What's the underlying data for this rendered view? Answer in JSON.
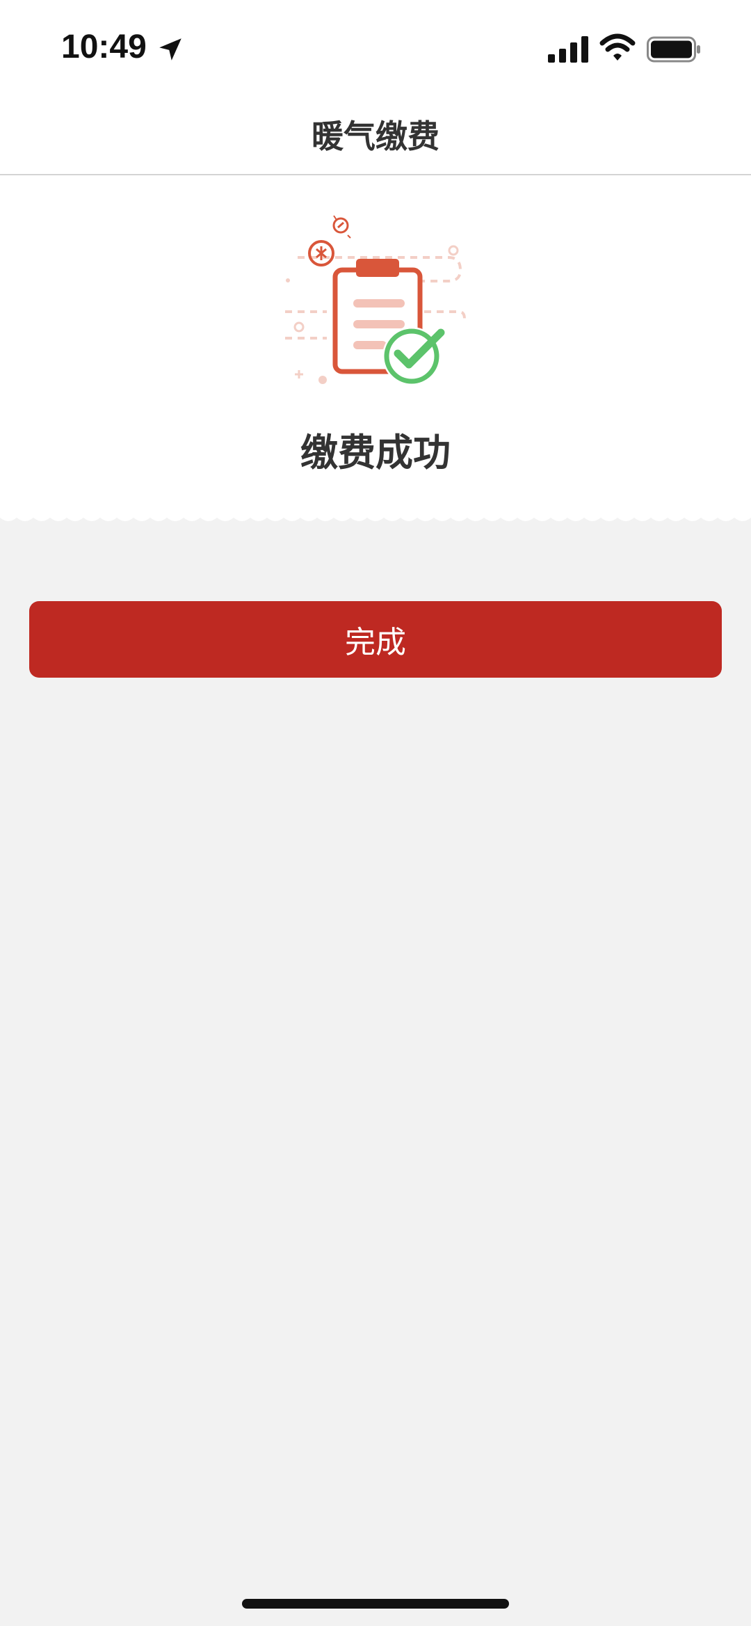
{
  "status_bar": {
    "time": "10:49",
    "icons": [
      "location-arrow-icon",
      "cellular-signal-icon",
      "wifi-icon",
      "battery-icon"
    ]
  },
  "nav": {
    "title": "暖气缴费"
  },
  "result": {
    "title": "缴费成功",
    "icon": "clipboard-checkmark-icon"
  },
  "actions": {
    "done_label": "完成"
  },
  "colors": {
    "accent": "#be2922",
    "success_green": "#5cc36b",
    "icon_orange": "#d9563a",
    "background": "#f2f2f2"
  }
}
